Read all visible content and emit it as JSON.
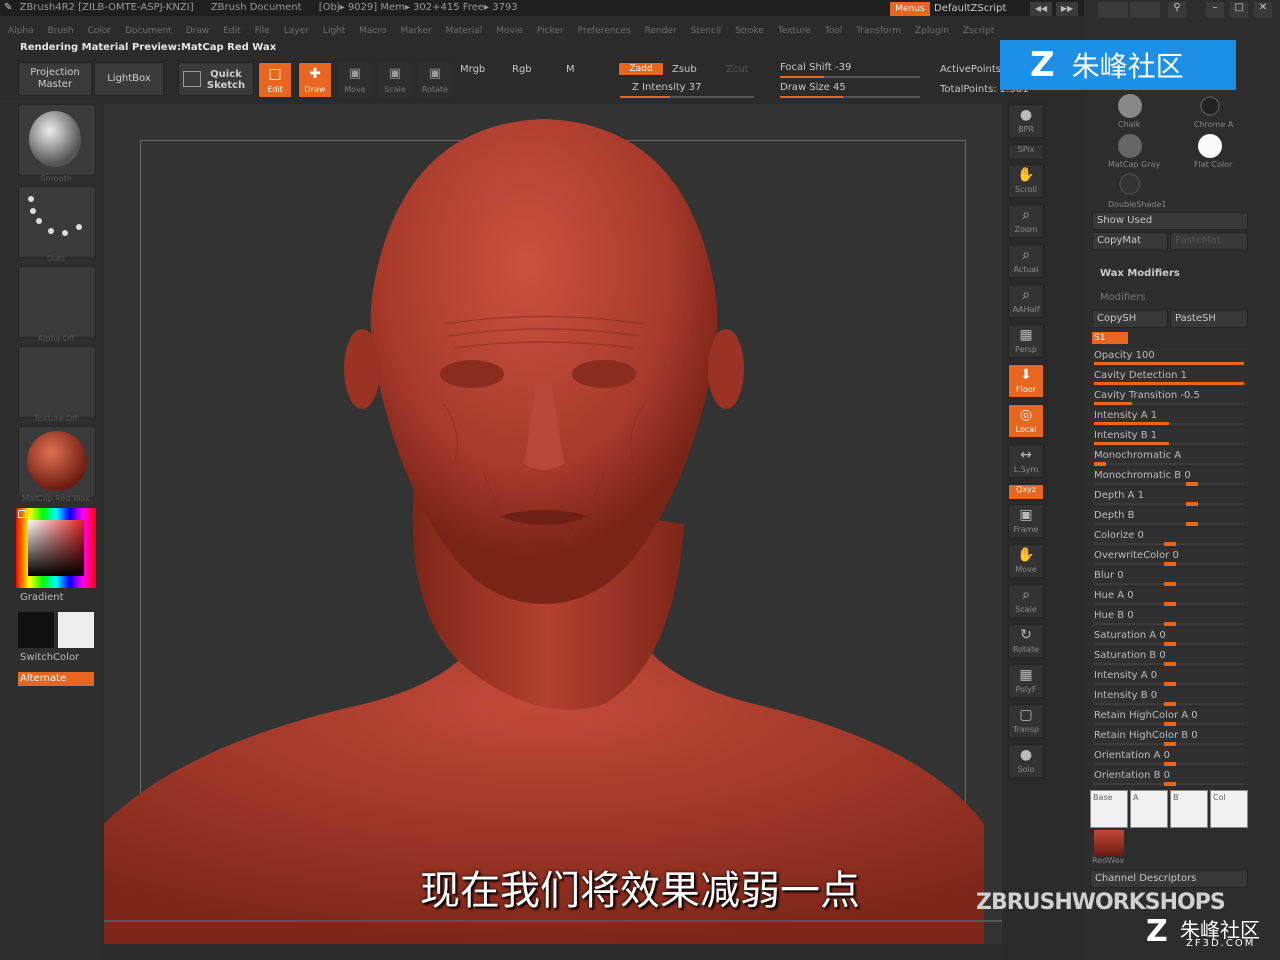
{
  "titlebar": {
    "app": "ZBrush4R2 [ZILB-OMTE-ASPJ-KNZI]",
    "doc": "ZBrush Document",
    "obj": "[Obj▸ 9029] Mem▸ 302+415 Free▸ 3793",
    "menus_btn": "Menus",
    "script": "DefaultZScript"
  },
  "menubar": [
    "Alpha",
    "Brush",
    "Color",
    "Document",
    "Draw",
    "Edit",
    "File",
    "Layer",
    "Light",
    "Macro",
    "Marker",
    "Material",
    "Movie",
    "Picker",
    "Preferences",
    "Render",
    "Stencil",
    "Stroke",
    "Texture",
    "Tool",
    "Transform",
    "Zplugin",
    "Zscript"
  ],
  "status": "Rendering Material Preview:MatCap Red Wax",
  "toolbar": {
    "projection_master": "Projection Master",
    "lightbox": "LightBox",
    "quick_sketch": "Quick Sketch",
    "edit": "Edit",
    "draw": "Draw",
    "move": "Move",
    "scale": "Scale",
    "rotate": "Rotate",
    "mrgb": "Mrgb",
    "rgb": "Rgb",
    "m": "M",
    "zadd": "Zadd",
    "zsub": "Zsub",
    "zcut": "Zcut",
    "z_intensity": "Z Intensity 37",
    "focal_shift": "Focal Shift -39",
    "draw_size": "Draw Size 45",
    "active_points": "ActivePoints",
    "total_points": "TotalPoints: 2.381"
  },
  "z_intensity_value": 37,
  "draw_size_value": 45,
  "leftpanel": {
    "brush_label": "Smooth",
    "stroke_label": "Dots",
    "alpha_label": "Alpha Off",
    "texture_label": "Texture Off",
    "material_label": "MatCap Red Wax",
    "gradient": "Gradient",
    "switchcolor": "SwitchColor",
    "alternate": "Alternate"
  },
  "rightshelf": [
    {
      "id": "bpr",
      "icon": "●",
      "label": "BPR"
    },
    {
      "id": "spix",
      "icon": "",
      "label": "SPix"
    },
    {
      "id": "scroll",
      "icon": "✋",
      "label": "Scroll"
    },
    {
      "id": "zoom",
      "icon": "⌕",
      "label": "Zoom"
    },
    {
      "id": "actual",
      "icon": "⌕",
      "label": "Actual"
    },
    {
      "id": "aahalf",
      "icon": "⌕",
      "label": "AAHalf"
    },
    {
      "id": "persp",
      "icon": "▦",
      "label": "Persp"
    },
    {
      "id": "floor",
      "icon": "⬇",
      "label": "Floor"
    },
    {
      "id": "local",
      "icon": "◎",
      "label": "Local"
    },
    {
      "id": "lsym",
      "icon": "↔",
      "label": "L.Sym"
    },
    {
      "id": "xyz",
      "icon": "",
      "label": "Qxyz"
    },
    {
      "id": "frame",
      "icon": "▣",
      "label": "Frame"
    },
    {
      "id": "move",
      "icon": "✋",
      "label": "Move"
    },
    {
      "id": "scale",
      "icon": "⌕",
      "label": "Scale"
    },
    {
      "id": "rotate",
      "icon": "↻",
      "label": "Rotate"
    },
    {
      "id": "polyf",
      "icon": "▦",
      "label": "PolyF"
    },
    {
      "id": "transp",
      "icon": "▢",
      "label": "Transp"
    },
    {
      "id": "solo",
      "icon": "●",
      "label": "Solo"
    }
  ],
  "tray": {
    "materials": [
      "Chalk",
      "Chrome A",
      "MatCap Gray",
      "Flat Color",
      "DoubleShade1"
    ],
    "show_used": "Show Used",
    "copymat": "CopyMat",
    "pastemat": "PasteMat",
    "wax_modifiers": "Wax Modifiers",
    "modifiers_title": "Modifiers",
    "copysh": "CopySH",
    "pastesh": "PasteSH",
    "s1": "S1",
    "modifiers": [
      {
        "label": "Opacity 100",
        "value": 1.0
      },
      {
        "label": "Cavity Detection 1",
        "value": 1.0
      },
      {
        "label": "Cavity Transition -0.5",
        "value": 0.25
      },
      {
        "label": "Intensity A 1",
        "value": 0.5
      },
      {
        "label": "Intensity B 1",
        "value": 0.5
      },
      {
        "label": "Monochromatic A",
        "value": 0.0
      },
      {
        "label": "Monochromatic B 0",
        "value": 0.66
      },
      {
        "label": "Depth A 1",
        "value": 0.66
      },
      {
        "label": "Depth B",
        "value": 0.66
      },
      {
        "label": "Colorize 0",
        "value": 0.5
      },
      {
        "label": "OverwriteColor 0",
        "value": 0.5
      },
      {
        "label": "Blur 0",
        "value": 0.5
      },
      {
        "label": "Hue A 0",
        "value": 0.5
      },
      {
        "label": "Hue B 0",
        "value": 0.5
      },
      {
        "label": "Saturation A 0",
        "value": 0.5
      },
      {
        "label": "Saturation B 0",
        "value": 0.5
      },
      {
        "label": "Intensity A 0",
        "value": 0.5
      },
      {
        "label": "Intensity B 0",
        "value": 0.5
      },
      {
        "label": "Retain HighColor A 0",
        "value": 0.5
      },
      {
        "label": "Retain HighColor B 0",
        "value": 0.5
      },
      {
        "label": "Orientation A 0",
        "value": 0.5
      },
      {
        "label": "Orientation B 0",
        "value": 0.5
      }
    ],
    "channels": [
      "Base",
      "A",
      "B",
      "Col"
    ],
    "redwax": "RedWax",
    "channel_descriptors": "Channel Descriptors"
  },
  "watermark_top": "朱峰社区",
  "watermark_bottom": "朱峰社区",
  "watermark_bottom_url": "ZF3D.COM",
  "workshops": "ZBRUSHWORKSHOPS",
  "subtitle": "现在我们将效果减弱一点",
  "colors": {
    "accent": "#e8661d",
    "wax": "#b23a2a",
    "watermark_blue": "#1e8fe6"
  }
}
